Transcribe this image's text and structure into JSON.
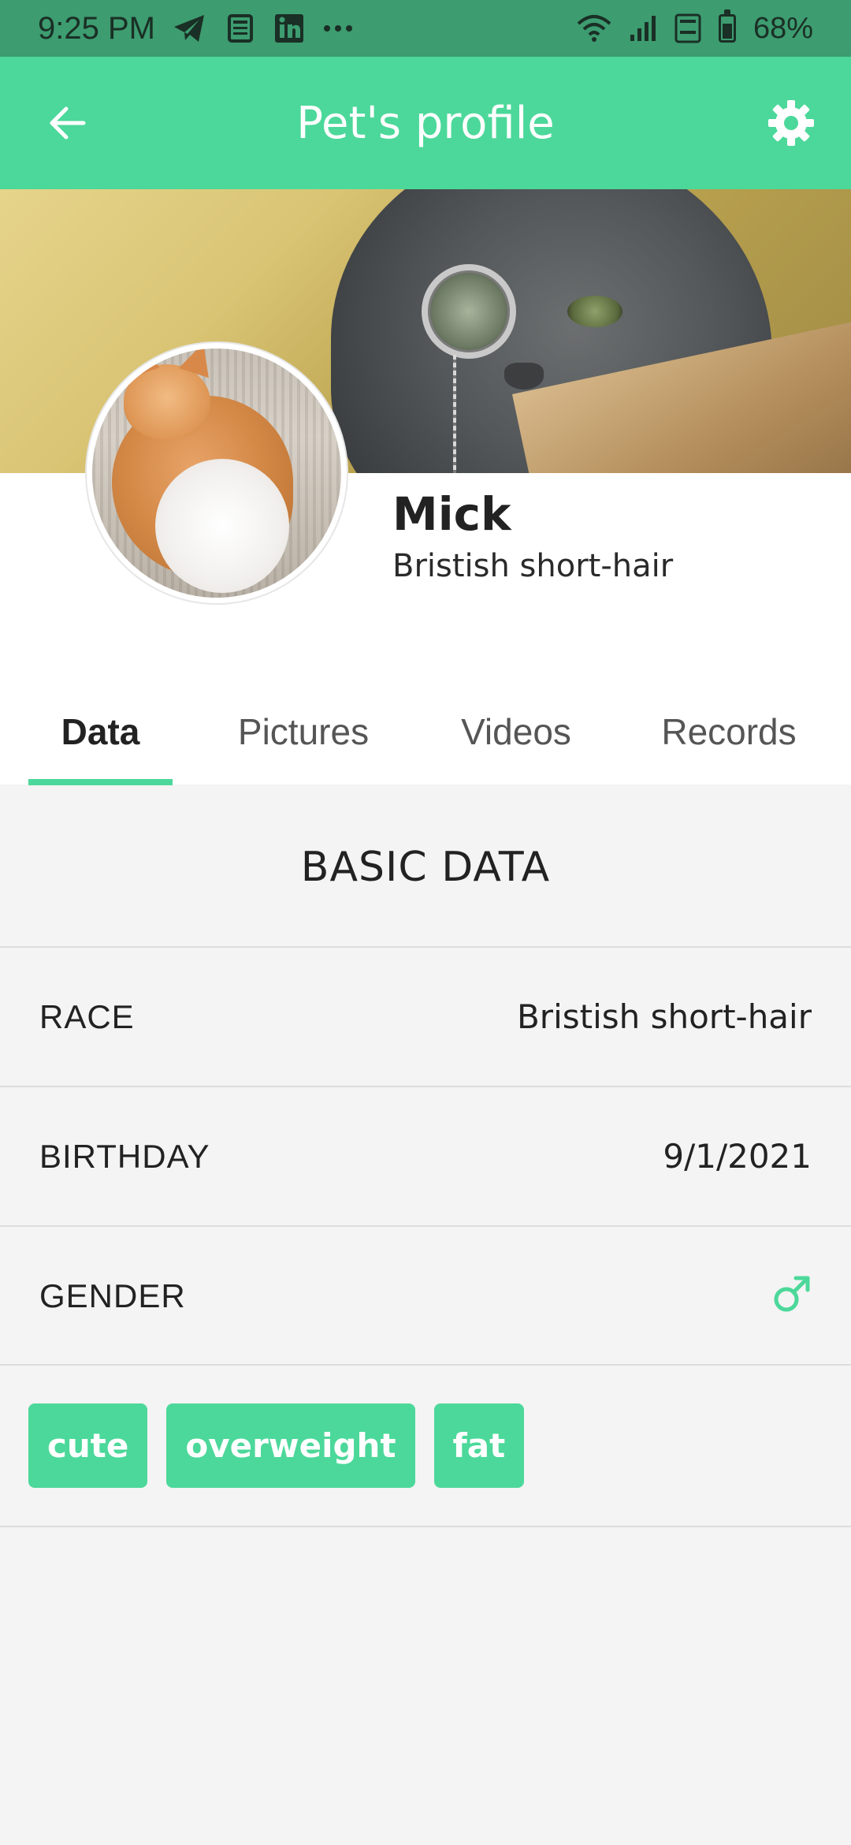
{
  "status_bar": {
    "time": "9:25 PM",
    "battery": "68%",
    "notification_icons": [
      "telegram-icon",
      "news-icon",
      "linkedin-icon",
      "more-dots-icon"
    ],
    "system_icons": [
      "wifi-icon",
      "signal-icon",
      "volte-icon",
      "battery-icon"
    ]
  },
  "app_bar": {
    "title": "Pet's profile",
    "back_icon": "arrow-left-icon",
    "settings_icon": "gear-icon"
  },
  "pet": {
    "name": "Mick",
    "breed": "Bristish short-hair"
  },
  "tabs": [
    {
      "label": "Data",
      "active": true
    },
    {
      "label": "Pictures",
      "active": false
    },
    {
      "label": "Videos",
      "active": false
    },
    {
      "label": "Records",
      "active": false
    }
  ],
  "basic_data": {
    "title": "BASIC DATA",
    "race_label": "RACE",
    "race_value": "Bristish short-hair",
    "birthday_label": "BIRTHDAY",
    "birthday_value": "9/1/2021",
    "gender_label": "GENDER",
    "gender_icon": "male-symbol-icon"
  },
  "tags": [
    "cute",
    "overweight",
    "fat"
  ],
  "colors": {
    "accent": "#4cd89a",
    "status_bar": "#3d9c70",
    "background": "#f4f4f4"
  }
}
